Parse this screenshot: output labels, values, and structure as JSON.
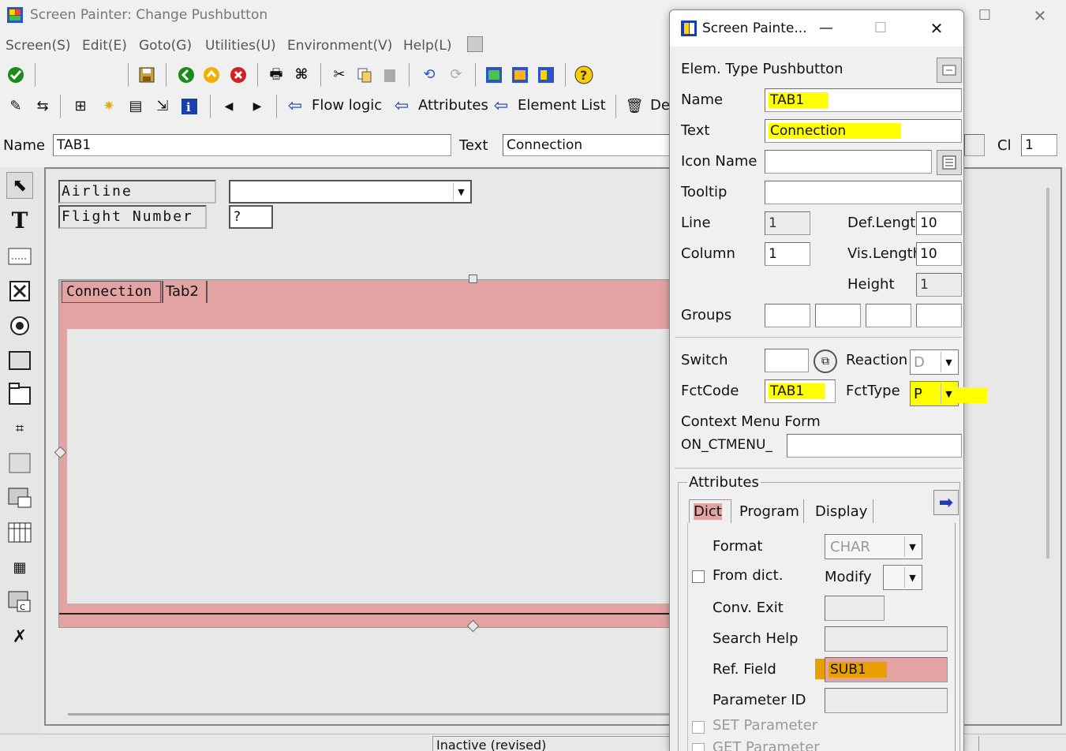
{
  "window": {
    "title": "Screen Painter:  Change Pushbutton"
  },
  "menubar": [
    "Screen(S)",
    "Edit(E)",
    "Goto(G)",
    "Utilities(U)",
    "Environment(V)",
    "Help(L)"
  ],
  "toolbar2": {
    "flow_logic": "Flow logic",
    "attributes": "Attributes",
    "element_list": "Element List",
    "delete_partial": "Del"
  },
  "namebar": {
    "name_label": "Name",
    "name_value": "TAB1",
    "text_label": "Text",
    "text_value": "Connection",
    "cl_label": "Cl",
    "cl_value": "1"
  },
  "canvas": {
    "airline_label": "Airline",
    "flight_label": "Flight Number",
    "flight_value": "?",
    "tab1_label": "Connection",
    "tab2_label": "Tab2"
  },
  "status": {
    "text": "Inactive (revised)"
  },
  "dialog": {
    "title": "Screen Painte...",
    "elem_type_label": "Elem. Type Pushbutton",
    "name_label": "Name",
    "name_value": "TAB1",
    "text_label": "Text",
    "text_value": "Connection",
    "icon_name_label": "Icon Name",
    "icon_name_value": "",
    "tooltip_label": "Tooltip",
    "tooltip_value": "",
    "line_label": "Line",
    "line_value": "1",
    "def_length_label": "Def.Length",
    "def_length_value": "10",
    "column_label": "Column",
    "column_value": "1",
    "vis_length_label": "Vis.Length",
    "vis_length_value": "10",
    "height_label": "Height",
    "height_value": "1",
    "groups_label": "Groups",
    "switch_label": "Switch",
    "reaction_label": "Reaction",
    "reaction_value": "D",
    "fctcode_label": "FctCode",
    "fctcode_value": "TAB1",
    "fcttype_label": "FctType",
    "fcttype_value": "P",
    "context_menu_label": "Context Menu Form",
    "context_prefix": "ON_CTMENU_",
    "attributes_group": "Attributes",
    "tabs": [
      "Dict",
      "Program",
      "Display"
    ],
    "format_label": "Format",
    "format_value": "CHAR",
    "from_dict_label": "From dict.",
    "modify_label": "Modify",
    "conv_exit_label": "Conv. Exit",
    "search_help_label": "Search Help",
    "ref_field_label": "Ref. Field",
    "ref_field_value": "SUB1",
    "parameter_id_label": "Parameter ID",
    "set_param_label": "SET Parameter",
    "get_param_label": "GET Parameter"
  },
  "colors": {
    "highlight": "#ffff00",
    "tabstrip": "#e3a3a3",
    "ref_highlight": "#e8a000"
  }
}
